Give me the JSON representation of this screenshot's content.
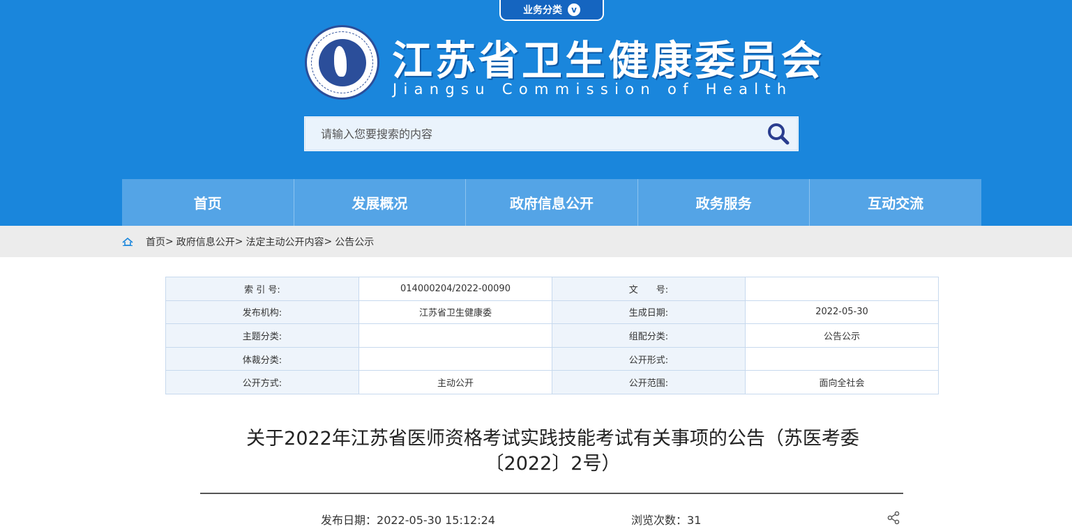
{
  "header": {
    "biz_tab_label": "业务分类",
    "biz_tab_icon": "v",
    "title_cn": "江苏省卫生健康委员会",
    "title_en": "Jiangsu Commission of Health",
    "emblem_text": "Jiangsu Commission of Health 江苏省卫生健康委员会",
    "search_placeholder": "请输入您要搜索的内容",
    "search_icon": "search-icon"
  },
  "nav": [
    "首页",
    "发展概况",
    "政府信息公开",
    "政务服务",
    "互动交流"
  ],
  "breadcrumb": {
    "home_icon": "home-icon",
    "items": [
      "首页",
      "政府信息公开",
      "法定主动公开内容",
      "公告公示"
    ],
    "separator": ">"
  },
  "meta_table": [
    [
      "索 引 号:",
      "014000204/2022-00090",
      "文　　号:",
      ""
    ],
    [
      "发布机构:",
      "江苏省卫生健康委",
      "生成日期:",
      "2022-05-30"
    ],
    [
      "主题分类:",
      "",
      "组配分类:",
      "公告公示"
    ],
    [
      "体裁分类:",
      "",
      "公开形式:",
      ""
    ],
    [
      "公开方式:",
      "主动公开",
      "公开范围:",
      "面向全社会"
    ]
  ],
  "article": {
    "title_line1": "关于2022年江苏省医师资格考试实践技能考试有关事项的公告（苏医考委",
    "title_line2": "〔2022〕2号）",
    "pubdate_label": "发布日期：",
    "pubdate_value": "2022-05-30 15:12:24",
    "views_label": "浏览次数：",
    "views_value": "31",
    "share_icon": "share-icon"
  },
  "colors": {
    "header_bg": "#1a86dc",
    "nav_bg": "#54a4e6",
    "crumb_bg": "#ececec",
    "table_key_bg": "#eef4fb",
    "table_border": "#c7d9ee"
  }
}
